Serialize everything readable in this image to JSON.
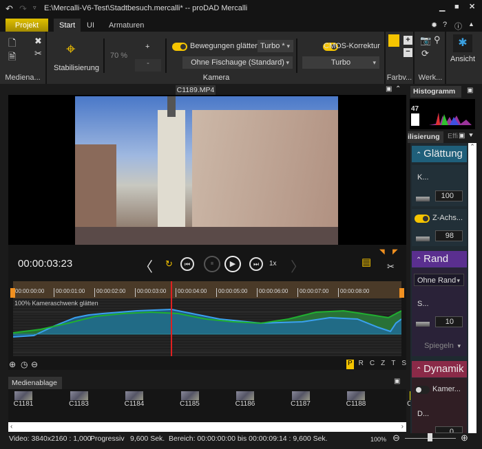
{
  "title": "E:\\Mercalli-V6-Test\\Stadtbesuch.mercalli* -- proDAD Mercalli",
  "tabs": [
    "Projekt",
    "Start",
    "UI",
    "Armaturen"
  ],
  "ribbon": {
    "media_group": "Mediena...",
    "stabilize_label": "Stabilisierung",
    "percent": "70 %",
    "plus": "+",
    "minus": "-",
    "smooth_toggle": "Bewegungen glätten",
    "smooth_mode": "Turbo *",
    "fisheye": "Ohne Fischauge (Standard)",
    "camera_group": "Kamera",
    "cmos_toggle": "CMOS-Korrektur",
    "cmos_mode": "Turbo",
    "farb_group": "Farbv...",
    "werk_group": "Werk...",
    "view_label": "Ansicht"
  },
  "clip_tab": "C1189.MP4",
  "transport": {
    "timecode": "00:00:03:23",
    "speed": "1x"
  },
  "timeline": {
    "ticks": [
      "00:00:00:00",
      "00:00:01:00",
      "00:00:02:00",
      "00:00:03:00",
      "00:00:04:00",
      "00:00:05:00",
      "00:00:06:00",
      "00:00:07:00",
      "00:00:08:00"
    ],
    "graph_label": "100% Kameraschwenk glätten",
    "modes": [
      "P",
      "R",
      "C",
      "Z",
      "T",
      "S"
    ],
    "active_mode": "P",
    "accent": "#f5c400"
  },
  "media": {
    "title": "Medienablage",
    "clips": [
      "C1181",
      "C1183",
      "C1184",
      "C1185",
      "C1186",
      "C1187",
      "C1188",
      "C1"
    ]
  },
  "panel": {
    "histogram_tab": "Histogramm",
    "histogram_value": "47",
    "tab1": "ilisierung",
    "tab2": "Effi",
    "smooth": {
      "title": "Glättung",
      "k_label": "K...",
      "k_value": "100",
      "z_label": "Z-Achs...",
      "z_value": "98",
      "color": "#1f5f7a"
    },
    "border": {
      "title": "Rand",
      "mode": "Ohne Rand",
      "s_label": "S...",
      "s_value": "10",
      "mirror": "Spiegeln",
      "color": "#5a2f8f"
    },
    "dynamic": {
      "title": "Dynamik",
      "cam_label": "Kamer...",
      "d_label": "D...",
      "d_value": "0",
      "color": "#8a2a48"
    }
  },
  "status": {
    "video": "Video: 3840x2160 : 1,000",
    "scan": "Progressiv",
    "duration": "9,600 Sek.",
    "range": "Bereich: 00:00:00:00 bis 00:00:09:14 : 9,600 Sek.",
    "zoom": "100%"
  }
}
